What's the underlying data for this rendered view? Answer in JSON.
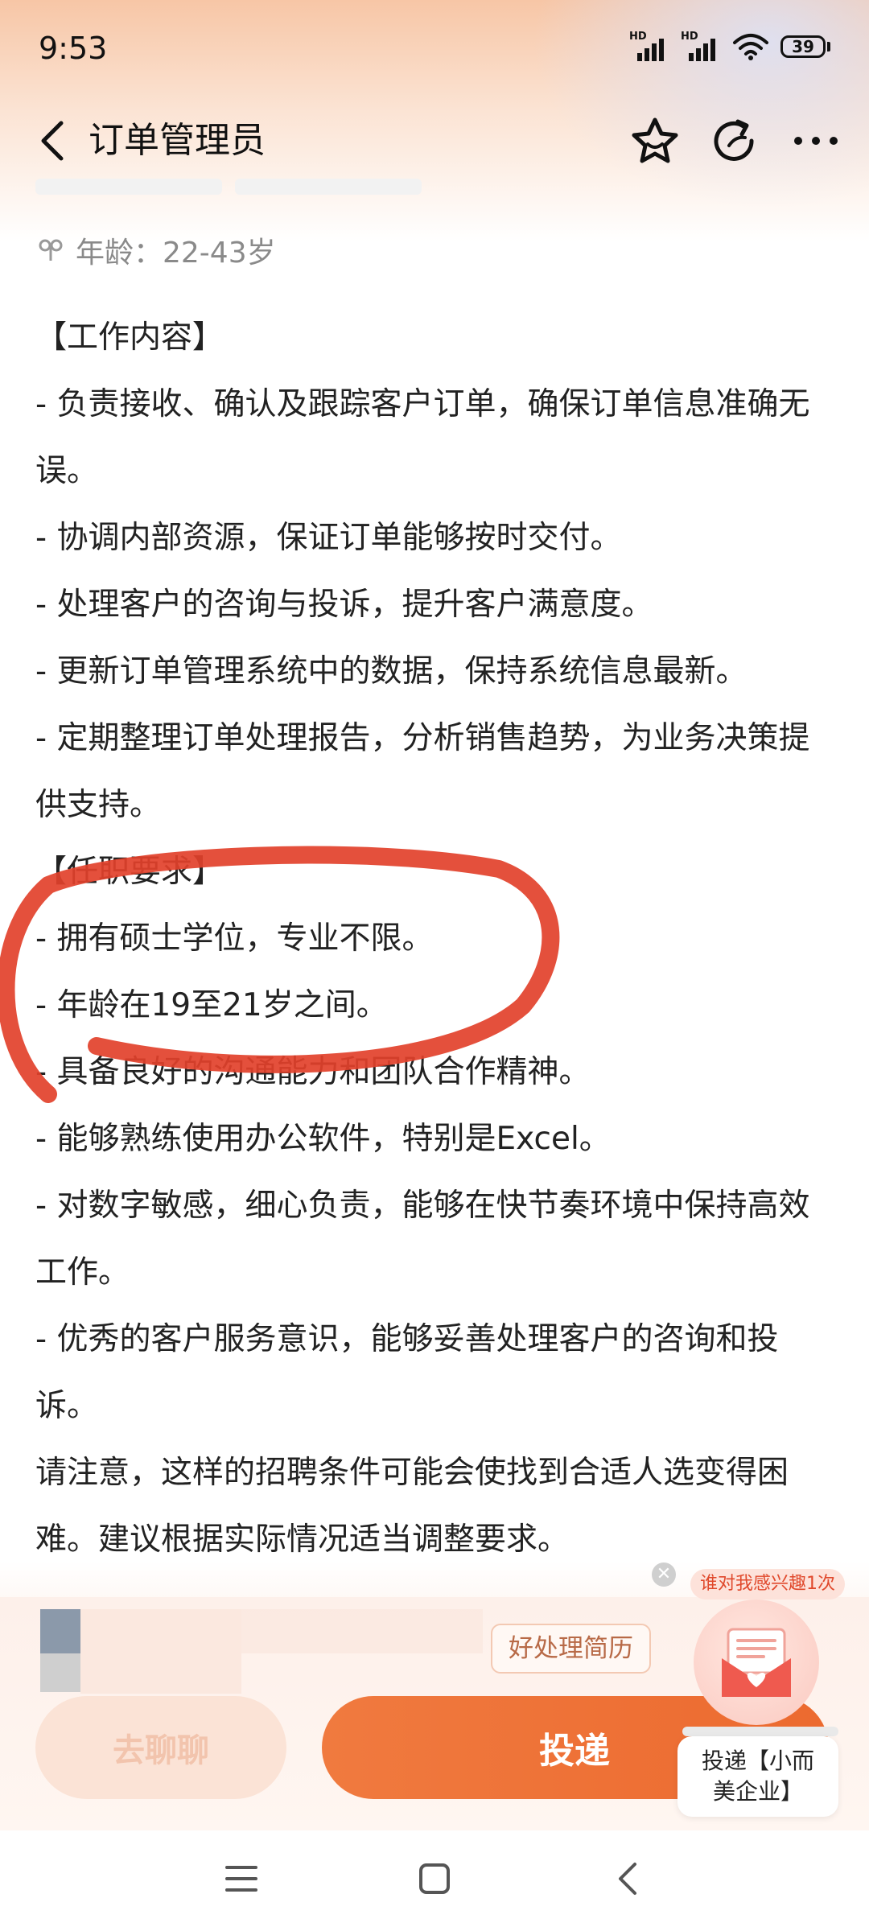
{
  "status_bar": {
    "time": "9:53",
    "battery": "39",
    "hd1": "HD",
    "hd2": "HD"
  },
  "nav": {
    "title": "订单管理员",
    "back_icon": "chevron-left-icon",
    "star_icon": "star-icon",
    "share_icon": "share-icon",
    "more_icon": "more-dots-icon"
  },
  "job": {
    "age_label": "年龄：22-43岁",
    "lines": [
      "【工作内容】",
      "- 负责接收、确认及跟踪客户订单，确保订单信息准确无误。",
      "- 协调内部资源，保证订单能够按时交付。",
      "- 处理客户的咨询与投诉，提升客户满意度。",
      "- 更新订单管理系统中的数据，保持系统信息最新。",
      "- 定期整理订单处理报告，分析销售趋势，为业务决策提供支持。",
      "【任职要求】",
      "- 拥有硕士学位，专业不限。",
      "- 年龄在19至21岁之间。",
      "- 具备良好的沟通能力和团队合作精神。",
      "- 能够熟练使用办公软件，特别是Excel。",
      "- 对数字敏感，细心负责，能够在快节奏环境中保持高效工作。",
      "- 优秀的客户服务意识，能够妥善处理客户的咨询和投诉。",
      "请注意，这样的招聘条件可能会使找到合适人选变得困难。建议根据实际情况适当调整要求。"
    ]
  },
  "bottom": {
    "resume_tip": "好处理简历",
    "chat_button": "去聊聊",
    "apply_button": "投递",
    "float_badge": "谁对我感兴趣1次",
    "float_label_line1": "投递【小而",
    "float_label_line2": "美企业】"
  },
  "colors": {
    "accent": "#ec6a2f",
    "annotation": "#e2412b"
  }
}
